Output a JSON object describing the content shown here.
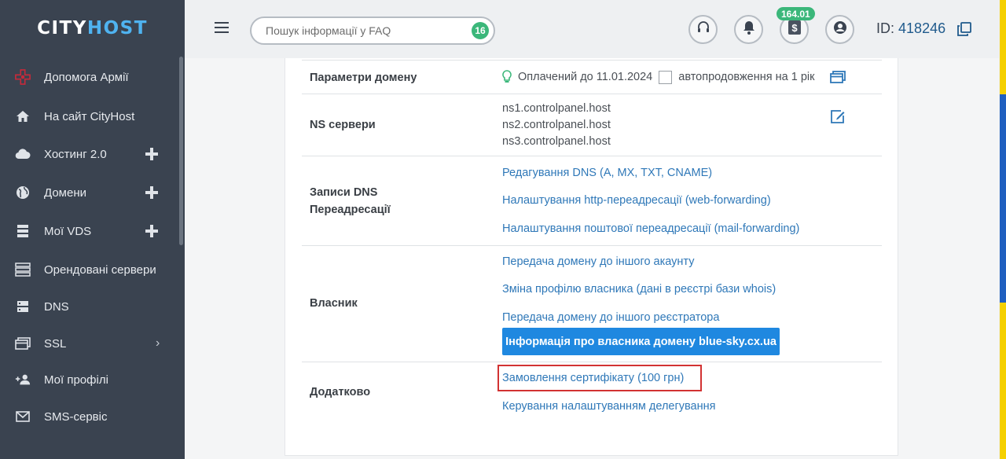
{
  "brand": {
    "part1": "CITY",
    "part2": "HOST"
  },
  "sidebar": {
    "items": [
      {
        "label": "Допомога Армії",
        "icon": "army-cross-icon",
        "expand": ""
      },
      {
        "label": "На сайт CityHost",
        "icon": "home-icon",
        "expand": ""
      },
      {
        "label": "Хостинг 2.0",
        "icon": "cloud-icon",
        "expand": "plus"
      },
      {
        "label": "Домени",
        "icon": "globe-icon",
        "expand": "plus"
      },
      {
        "label": "Мої VDS",
        "icon": "server-icon",
        "expand": "plus"
      },
      {
        "label": "Орендовані сервери",
        "icon": "server-stack-icon",
        "expand": ""
      },
      {
        "label": "DNS",
        "icon": "dns-icon",
        "expand": ""
      },
      {
        "label": "SSL",
        "icon": "ssl-icon",
        "expand": "chevron"
      },
      {
        "label": "Мої профілі",
        "icon": "users-icon",
        "expand": ""
      },
      {
        "label": "SMS-сервіс",
        "icon": "mail-icon",
        "expand": ""
      }
    ]
  },
  "header": {
    "search_placeholder": "Пошук інформації у FAQ",
    "search_badge": "16",
    "balance": "164.01",
    "user_id_label": "ID:",
    "user_id": "418246"
  },
  "domain": {
    "params": {
      "label": "Параметри домену",
      "paid_until": "Оплачений до 11.01.2024",
      "autorenew": "автопродовження на 1 рік"
    },
    "ns": {
      "label": "NS сервери",
      "servers": [
        "ns1.controlpanel.host",
        "ns2.controlpanel.host",
        "ns3.controlpanel.host"
      ]
    },
    "dns": {
      "label_line1": "Записи DNS",
      "label_line2": "Переадресації",
      "links": [
        "Редагування DNS (A, MX, TXT, CNAME)",
        "Налаштування http-переадресації (web-forwarding)",
        "Налаштування поштової переадресації (mail-forwarding)"
      ]
    },
    "owner": {
      "label": "Власник",
      "links": [
        "Передача домену до іншого акаунту",
        "Зміна профілю власника (дані в реєстрі бази whois)",
        "Передача домену до іншого реєстратора"
      ],
      "button": "Інформація про власника домену blue-sky.cx.ua"
    },
    "extra": {
      "label": "Додатково",
      "links": [
        "Замовлення сертифікату (100 грн)",
        "Керування налаштуванням делегування"
      ]
    }
  },
  "colors": {
    "sidebar": "#3a4350",
    "accent": "#1f88e0",
    "link": "#2f78b8",
    "badge": "#3bb77a",
    "highlight": "#d23232",
    "flag_blue": "#1f5fbf",
    "flag_yellow": "#f5d000"
  }
}
